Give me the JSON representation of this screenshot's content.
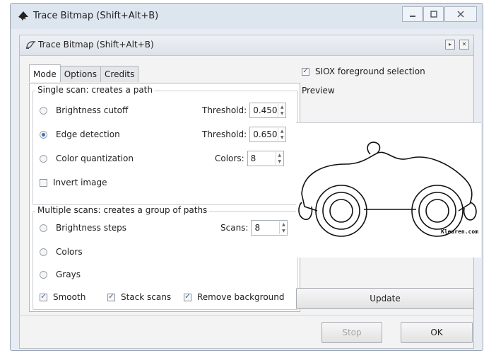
{
  "window": {
    "title": "Trace Bitmap (Shift+Alt+B)"
  },
  "panel": {
    "title": "Trace Bitmap (Shift+Alt+B)"
  },
  "tabs": [
    {
      "label": "Mode",
      "active": true
    },
    {
      "label": "Options",
      "active": false
    },
    {
      "label": "Credits",
      "active": false
    }
  ],
  "single_scan": {
    "legend": "Single scan: creates a path",
    "options": [
      {
        "label": "Brightness cutoff",
        "selected": false,
        "param_label": "Threshold:",
        "param_value": "0.450"
      },
      {
        "label": "Edge detection",
        "selected": true,
        "param_label": "Threshold:",
        "param_value": "0.650"
      },
      {
        "label": "Color quantization",
        "selected": false,
        "param_label": "Colors:",
        "param_value": "8"
      }
    ],
    "invert": {
      "label": "Invert image",
      "checked": false
    }
  },
  "multiple_scans": {
    "legend": "Multiple scans: creates a group of paths",
    "options": [
      {
        "label": "Brightness steps",
        "selected": false,
        "param_label": "Scans:",
        "param_value": "8"
      },
      {
        "label": "Colors",
        "selected": false
      },
      {
        "label": "Grays",
        "selected": false
      }
    ],
    "checks": [
      {
        "label": "Smooth",
        "checked": true
      },
      {
        "label": "Stack scans",
        "checked": true
      },
      {
        "label": "Remove background",
        "checked": true
      }
    ]
  },
  "siox": {
    "label": "SIOX foreground selection",
    "checked": true
  },
  "preview": {
    "label": "Preview",
    "watermark": "Kleuren.com"
  },
  "buttons": {
    "update": "Update",
    "stop": "Stop",
    "ok": "OK"
  },
  "colors": {
    "accent": "#3b6fc4",
    "window_bg": "#e9edf3",
    "panel_bg": "#f3f3f3"
  }
}
